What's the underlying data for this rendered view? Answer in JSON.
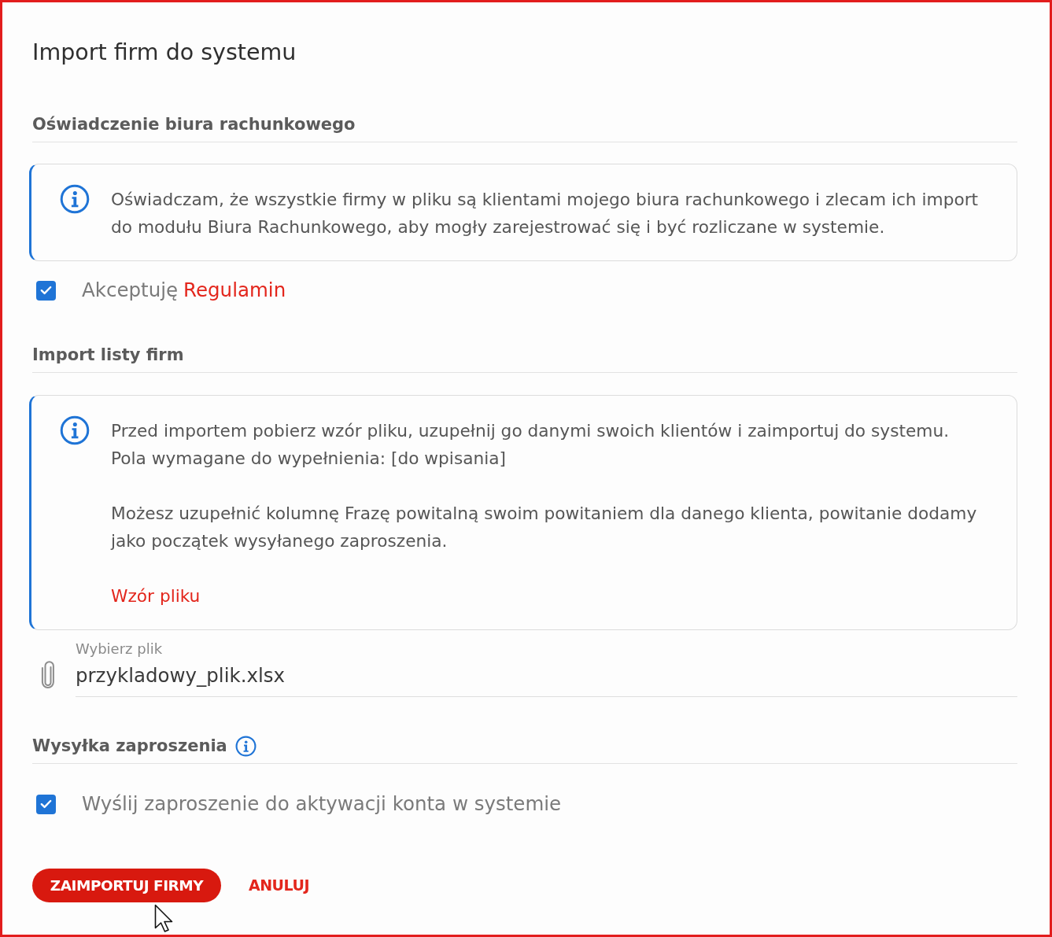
{
  "window": {
    "title": "Import firm do systemu"
  },
  "statement": {
    "heading": "Oświadczenie biura rachunkowego",
    "notice": {
      "paragraphs": [
        [
          "Oświadczam, że wszystkie firmy w pliku są klientami mojego biura rachunkowego i zlecam ich import do modułu Biura Rachunkowego, aby mogły zarejestrować się i być rozliczane w systemie."
        ]
      ]
    },
    "consent": {
      "checked": true,
      "label": "Akceptuję",
      "link": "Regulamin"
    }
  },
  "import_list": {
    "heading": "Import listy firm",
    "notice": {
      "paragraphs": [
        [
          "Przed importem pobierz wzór pliku, uzupełnij go danymi swoich klientów i zaimportuj do systemu.",
          "Pola wymagane do wypełnienia: [do wpisania]"
        ],
        [
          "Możesz uzupełnić kolumnę Frazę powitalną swoim powitaniem dla danego klienta, powitanie dodamy jako początek wysyłanego zaproszenia."
        ]
      ],
      "link": "Wzór pliku"
    },
    "file_field": {
      "label": "Wybierz plik",
      "value": "przykladowy_plik.xlsx"
    }
  },
  "invitation": {
    "heading": "Wysyłka zaproszenia",
    "send": {
      "checked": true,
      "label": "Wyślij zaproszenie do aktywacji konta w systemie"
    }
  },
  "buttons": [
    {
      "kind": "primary",
      "label": "ZAIMPORTUJ FIRMY"
    },
    {
      "kind": "text",
      "label": "ANULUJ"
    }
  ]
}
